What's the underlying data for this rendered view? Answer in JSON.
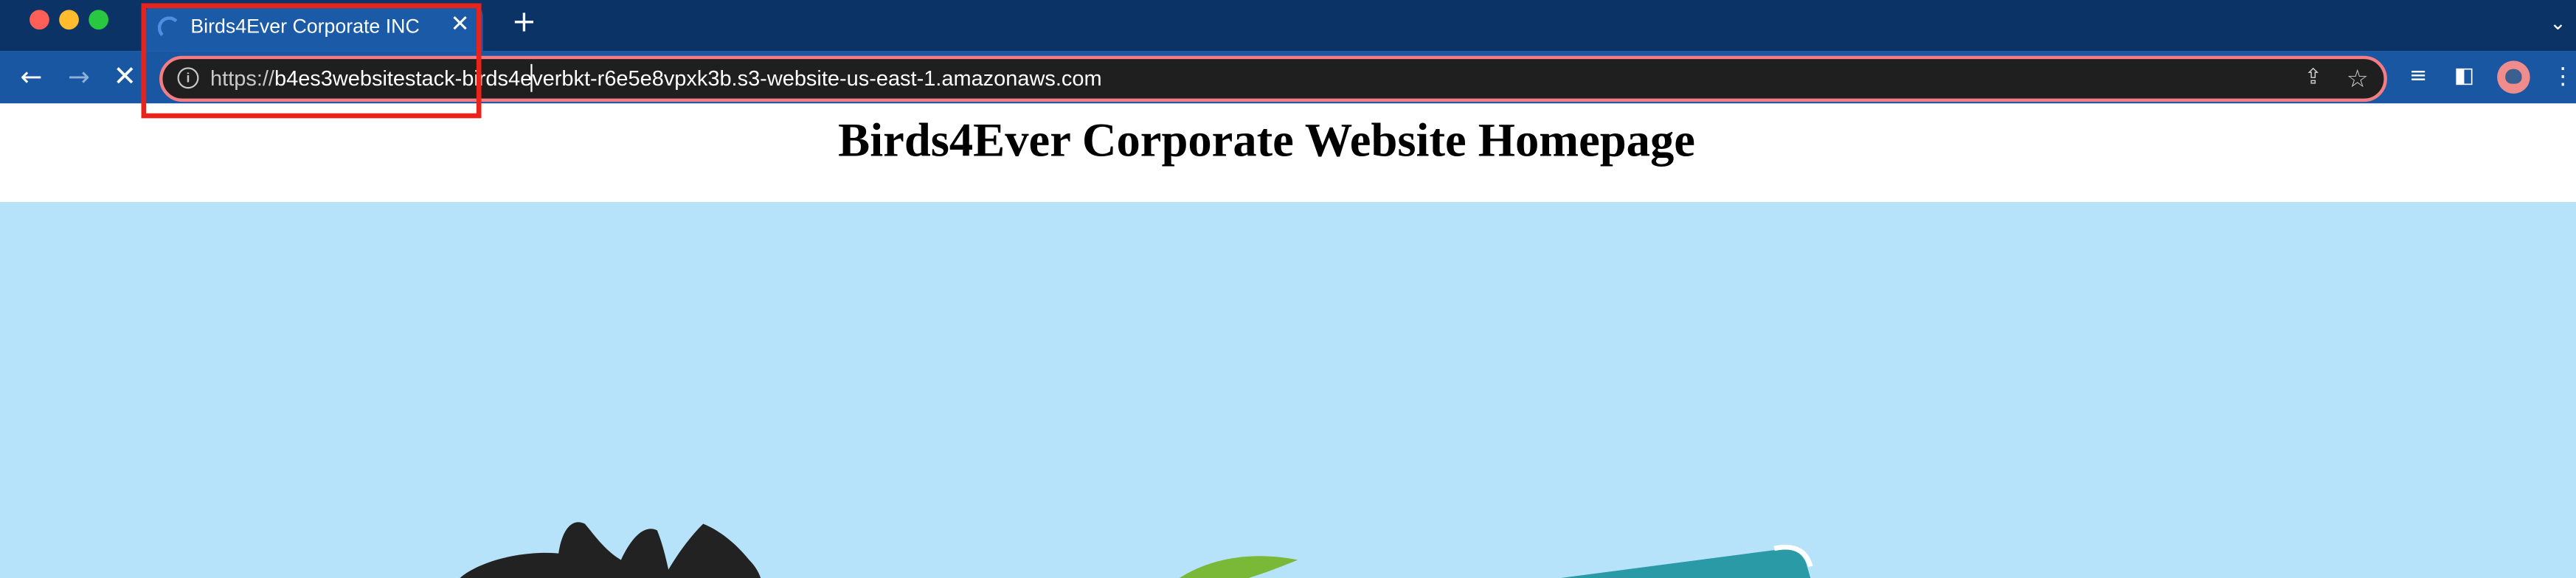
{
  "window": {
    "tab": {
      "title": "Birds4Ever Corporate INC",
      "close_glyph": "✕",
      "spinner_icon": "loading-spinner-icon"
    },
    "new_tab_glyph": "+",
    "tab_menu_glyph": "⌄"
  },
  "toolbar": {
    "back_glyph": "←",
    "forward_glyph": "→",
    "stop_glyph": "✕",
    "address": {
      "scheme": "https://",
      "host": "b4es3websitestack-birds4everbkt-r6e5e8vpxk3b.s3-website-us-east-1.amazonaws.com",
      "info_glyph": "i"
    },
    "share_glyph": "⇪",
    "star_glyph": "☆",
    "queue_glyph": "≡",
    "sidepanel_glyph": "◧",
    "menu_glyph": "⋮"
  },
  "page": {
    "heading": "Birds4Ever Corporate Website Homepage"
  },
  "colors": {
    "tabstrip": "#0b3366",
    "toolbar": "#1957a3",
    "active_tab": "#1a5aa6",
    "omnibox_bg": "#1f1f1f",
    "omnibox_border": "#f47c84",
    "hero_bg": "#b7e3fa",
    "highlight": "#e8231c"
  }
}
